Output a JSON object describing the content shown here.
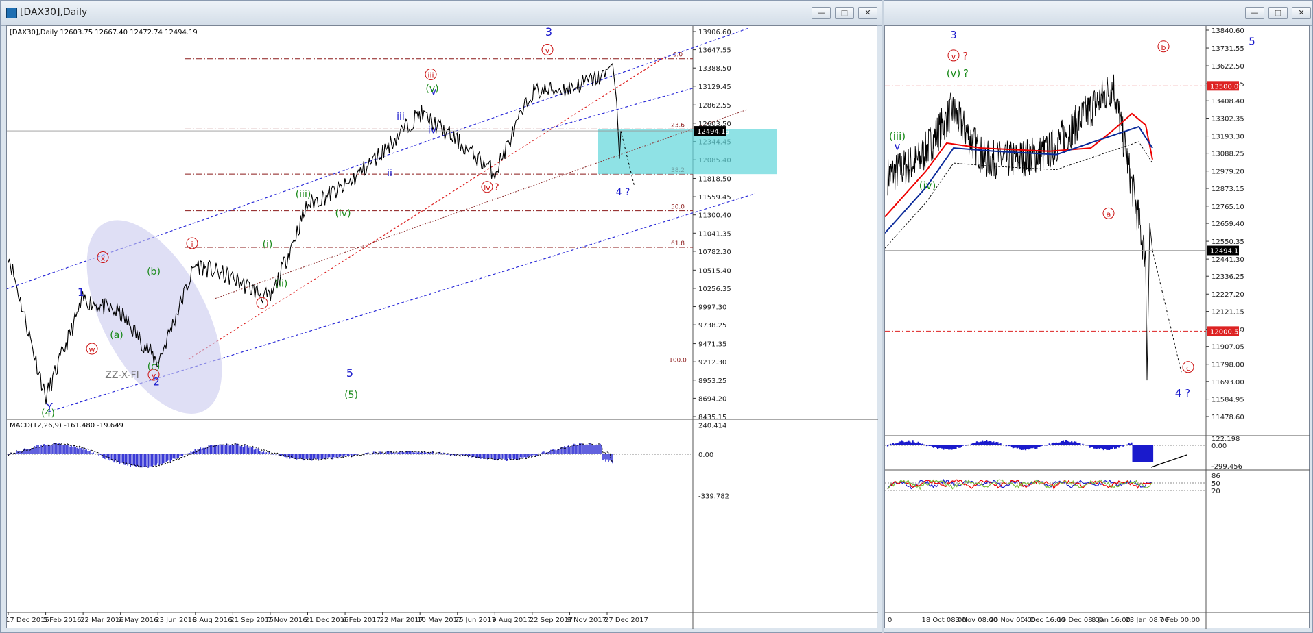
{
  "colors": {
    "candle": "#000000",
    "fib": "#8b1a1a",
    "channel": "#2a2ad8",
    "macd_hist": "#3b3bd6",
    "zone": "#5fd6da",
    "red_label": "#cc1111",
    "green_label": "#1a8a1a",
    "blue_label": "#1a1acc"
  },
  "left": {
    "title": "[DAX30],Daily",
    "info": "[DAX30],Daily  12603.75 12667.40 12472.74 12494.19",
    "price_labels": [
      "13906.60",
      "13647.55",
      "13388.50",
      "13129.45",
      "12862.55",
      "12603.50",
      "12344.45",
      "12085.40",
      "11818.50",
      "11559.45",
      "11300.40",
      "11041.35",
      "10782.30",
      "10515.40",
      "10256.35",
      "9997.30",
      "9738.25",
      "9471.35",
      "9212.30",
      "8953.25",
      "8694.20",
      "8435.15"
    ],
    "current_price": "12494.19",
    "fib_levels": [
      {
        "label": "0.0",
        "price": 13520
      },
      {
        "label": "23.6",
        "price": 12520
      },
      {
        "label": "38.2",
        "price": 11880
      },
      {
        "label": "50.0",
        "price": 11360
      },
      {
        "label": "61.8",
        "price": 10840
      },
      {
        "label": "100.0",
        "price": 9180
      }
    ],
    "date_labels": [
      "17 Dec 2015",
      "5 Feb 2016",
      "22 Mar 2016",
      "9 May 2016",
      "23 Jun 2016",
      "8 Aug 2016",
      "21 Sep 2016",
      "7 Nov 2016",
      "21 Dec 2016",
      "6 Feb 2017",
      "22 Mar 2017",
      "10 May 2017",
      "26 Jun 2017",
      "9 Aug 2017",
      "22 Sep 2017",
      "9 Nov 2017",
      "27 Dec 2017"
    ],
    "macd_label": "MACD(12,26,9) -161.480 -19.649",
    "macd_levels": [
      "240.414",
      "0.00",
      "-339.782"
    ],
    "wave_labels": [
      {
        "t": "x",
        "c": "red",
        "circ": true
      },
      {
        "t": "w",
        "c": "red",
        "circ": true
      },
      {
        "t": "y",
        "c": "red",
        "circ": true
      },
      {
        "t": "i",
        "c": "red",
        "circ": true
      },
      {
        "t": "ii",
        "c": "red",
        "circ": true
      },
      {
        "t": "iii",
        "c": "red",
        "circ": true
      },
      {
        "t": "iv",
        "c": "red",
        "circ": true
      },
      {
        "t": "?",
        "c": "red",
        "circ": false
      },
      {
        "t": "v",
        "c": "red",
        "circ": true
      },
      {
        "t": "1",
        "c": "blue",
        "circ": false
      },
      {
        "t": "2",
        "c": "blue",
        "circ": false
      },
      {
        "t": "3",
        "c": "blue",
        "circ": false
      },
      {
        "t": "4 ?",
        "c": "blue",
        "circ": false
      },
      {
        "t": "5",
        "c": "blue",
        "circ": false
      },
      {
        "t": "Y",
        "c": "blue",
        "circ": false
      },
      {
        "t": "iii",
        "c": "blue",
        "circ": false
      },
      {
        "t": "iv",
        "c": "blue",
        "circ": false
      },
      {
        "t": "v",
        "c": "blue",
        "circ": false
      },
      {
        "t": "ii",
        "c": "blue",
        "circ": false
      },
      {
        "t": "(4)",
        "c": "green",
        "circ": false
      },
      {
        "t": "(5)",
        "c": "green",
        "circ": false
      },
      {
        "t": "(a)",
        "c": "green",
        "circ": false
      },
      {
        "t": "(b)",
        "c": "green",
        "circ": false
      },
      {
        "t": "(c)",
        "c": "green",
        "circ": false
      },
      {
        "t": "(i)",
        "c": "green",
        "circ": false
      },
      {
        "t": "(ii)",
        "c": "green",
        "circ": false
      },
      {
        "t": "(iii)",
        "c": "green",
        "circ": false
      },
      {
        "t": "(iv)",
        "c": "green",
        "circ": false
      },
      {
        "t": "(v)",
        "c": "green",
        "circ": false
      },
      {
        "t": "ZZ-X-FI",
        "c": "gray",
        "circ": false
      }
    ]
  },
  "right": {
    "price_labels": [
      "13840.60",
      "13731.55",
      "13622.50",
      "13513.45",
      "13408.40",
      "13302.35",
      "13193.30",
      "13088.25",
      "12979.20",
      "12873.15",
      "12765.10",
      "12659.40",
      "12550.35",
      "12441.30",
      "12336.25",
      "12227.20",
      "12121.15",
      "12012.10",
      "11907.05",
      "11798.00",
      "11693.00",
      "11584.95",
      "11478.60"
    ],
    "line_13500": "13500.00",
    "line_12000": "12000.53",
    "current_price": "12494.19",
    "date_labels": [
      "0",
      "18 Oct 08:00",
      "3 Nov 08:00",
      "20 Nov 00:00",
      "4 Dec 16:00",
      "19 Dec 08:00",
      "8 Jan 16:00",
      "23 Jan 08:00",
      "7 Feb 00:00"
    ],
    "ind1_levels": [
      "122.198",
      "0.00",
      "-299.456"
    ],
    "ind2_levels": [
      "86",
      "50",
      "20"
    ],
    "wave_labels": [
      {
        "t": "3",
        "c": "blue",
        "circ": false
      },
      {
        "t": "v",
        "c": "red",
        "circ": true
      },
      {
        "t": "?",
        "c": "red",
        "circ": false
      },
      {
        "t": "(v)",
        "c": "green",
        "circ": false
      },
      {
        "t": "?",
        "c": "green",
        "circ": false
      },
      {
        "t": "(iii)",
        "c": "green",
        "circ": false
      },
      {
        "t": "v",
        "c": "blue",
        "circ": false
      },
      {
        "t": "(iv)",
        "c": "green",
        "circ": false
      },
      {
        "t": "a",
        "c": "red",
        "circ": true
      },
      {
        "t": "b",
        "c": "red",
        "circ": true
      },
      {
        "t": "c",
        "c": "red",
        "circ": true
      },
      {
        "t": "5",
        "c": "blue",
        "circ": false
      },
      {
        "t": "4 ?",
        "c": "blue",
        "circ": false
      }
    ]
  },
  "chart_data": [
    {
      "type": "line",
      "title": "[DAX30],Daily",
      "xlabel": "",
      "ylabel": "",
      "ylim": [
        8435.15,
        13906.6
      ],
      "x": [
        "17 Dec 2015",
        "5 Feb 2016",
        "22 Mar 2016",
        "9 May 2016",
        "23 Jun 2016",
        "8 Aug 2016",
        "21 Sep 2016",
        "7 Nov 2016",
        "21 Dec 2016",
        "6 Feb 2017",
        "22 Mar 2017",
        "10 May 2017",
        "26 Jun 2017",
        "9 Aug 2017",
        "22 Sep 2017",
        "9 Nov 2017",
        "27 Dec 2017"
      ],
      "series": [
        {
          "name": "",
          "values": [
            10750,
            8700,
            10100,
            9900,
            9200,
            10600,
            10400,
            10100,
            11450,
            11700,
            12200,
            12750,
            12350,
            11900,
            13050,
            13100,
            13300
          ]
        }
      ]
    },
    {
      "type": "line",
      "xlabel": "",
      "ylabel": "",
      "ylim": [
        11478.6,
        13840.6
      ],
      "x": [
        "0",
        "18 Oct 08:00",
        "3 Nov 08:00",
        "20 Nov 00:00",
        "4 Dec 16:00",
        "19 Dec 08:00",
        "8 Jan 16:00",
        "23 Jan 08:00",
        "7 Feb 00:00"
      ],
      "series": [
        {
          "name": "",
          "values": [
            12950,
            13050,
            13350,
            13050,
            13050,
            13100,
            13300,
            13500,
            12450
          ]
        }
      ]
    }
  ]
}
